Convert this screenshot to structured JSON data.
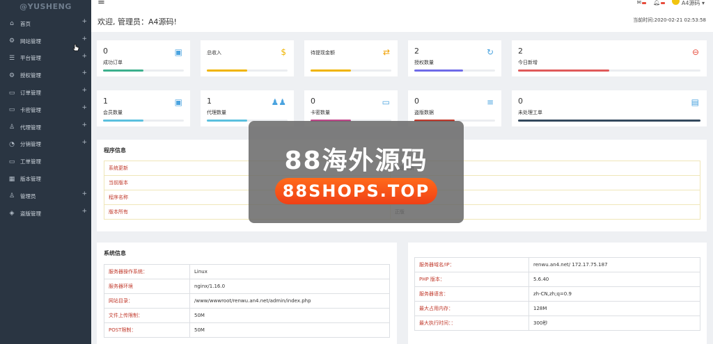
{
  "logo": "@YUSHENG",
  "sidebar": {
    "items": [
      {
        "label": "首页",
        "icon": "home-icon",
        "glyph": "⌂",
        "expand": "+"
      },
      {
        "label": "网站管理",
        "icon": "gear-icon",
        "glyph": "⚙",
        "expand": "+"
      },
      {
        "label": "平台管理",
        "icon": "list-icon",
        "glyph": "☰",
        "expand": "+"
      },
      {
        "label": "授权管理",
        "icon": "settings-icon",
        "glyph": "⚙",
        "expand": "+"
      },
      {
        "label": "订单管理",
        "icon": "folder-icon",
        "glyph": "▭",
        "expand": "+"
      },
      {
        "label": "卡密管理",
        "icon": "card-icon",
        "glyph": "▭",
        "expand": "+"
      },
      {
        "label": "代理管理",
        "icon": "users-icon",
        "glyph": "♙",
        "expand": "+"
      },
      {
        "label": "分销管理",
        "icon": "chart-icon",
        "glyph": "◔",
        "expand": "+"
      },
      {
        "label": "工单管理",
        "icon": "monitor-icon",
        "glyph": "▭",
        "expand": ""
      },
      {
        "label": "版本管理",
        "icon": "grid-icon",
        "glyph": "▦",
        "expand": ""
      },
      {
        "label": "管理员",
        "icon": "user-icon",
        "glyph": "♙",
        "expand": "+"
      },
      {
        "label": "盗版管理",
        "icon": "layers-icon",
        "glyph": "◈",
        "expand": "+"
      }
    ]
  },
  "topbar": {
    "menu_glyph": "≡",
    "welcome": "欢迎, 管理员：A4源码!",
    "username": "A4源码",
    "current_time": "当前时间:2020-02-21 02:53:58"
  },
  "cards": [
    {
      "num": "0",
      "label": "成功订单",
      "icon": "calendar-check-icon",
      "glyph": "▣",
      "color": "#4aa3df",
      "bar_color": "#3cb08d",
      "progress": 0.5
    },
    {
      "num": "",
      "label": "总收入",
      "icon": "dollar-icon",
      "glyph": "$",
      "color": "#f0b400",
      "bar_color": "#f0b400",
      "progress": 0.5
    },
    {
      "num": "",
      "label": "待提现金额",
      "icon": "exchange-icon",
      "glyph": "⇄",
      "color": "#f0a000",
      "bar_color": "#f0b400",
      "progress": 0.5
    },
    {
      "num": "2",
      "label": "授权数量",
      "icon": "refresh-icon",
      "glyph": "↻",
      "color": "#4aa3df",
      "bar_color": "#6e6be8",
      "progress": 0.6
    },
    {
      "num": "2",
      "label": "今日新增",
      "icon": "login-icon",
      "glyph": "⊖",
      "color": "#e74c3c",
      "bar_color": "#e05a5a",
      "progress": 0.5
    },
    {
      "num": "1",
      "label": "会员数量",
      "icon": "contact-icon",
      "glyph": "▣",
      "color": "#4aa3df",
      "bar_color": "#5bc0de",
      "progress": 0.5
    },
    {
      "num": "1",
      "label": "代理数量",
      "icon": "group-icon",
      "glyph": "♟♟",
      "color": "#4aa3df",
      "bar_color": "#5bc0de",
      "progress": 0.5
    },
    {
      "num": "0",
      "label": "卡密数量",
      "icon": "credit-card-icon",
      "glyph": "▭",
      "color": "#4aa3df",
      "bar_color": "#c0468a",
      "progress": 0.5
    },
    {
      "num": "0",
      "label": "盗版数据",
      "icon": "database-icon",
      "glyph": "≡",
      "color": "#4aa3df",
      "bar_color": "#c0392b",
      "progress": 0.5
    },
    {
      "num": "0",
      "label": "未处理工单",
      "icon": "file-icon",
      "glyph": "▤",
      "color": "#4aa3df",
      "bar_color": "#34495e",
      "progress": 1.0
    }
  ],
  "program_info": {
    "title": "程序信息",
    "rows": [
      {
        "key": "系统更新",
        "value": "已是最新"
      },
      {
        "key": "当前版本",
        "value": ""
      },
      {
        "key": "程序名称",
        "value": ""
      },
      {
        "key": "版本所有",
        "value": "正版"
      }
    ]
  },
  "system_info": {
    "title": "系统信息",
    "rows": [
      {
        "key": "服务器操作系统：",
        "value": "Linux"
      },
      {
        "key": "服务器环境",
        "value": "nginx/1.16.0"
      },
      {
        "key": "网站目录：",
        "value": "/www/wwwroot/renwu.an4.net/admin/index.php"
      },
      {
        "key": "文件上传限制：",
        "value": "50M"
      },
      {
        "key": "POST限制：",
        "value": "50M"
      }
    ]
  },
  "server_info": {
    "rows": [
      {
        "key": "服务器域名/IP：",
        "value": "renwu.an4.net/ 172.17.75.187"
      },
      {
        "key": "PHP 版本：",
        "value": "5.6.40"
      },
      {
        "key": "服务器语言：",
        "value": "zh-CN,zh;q=0.9"
      },
      {
        "key": "最大占用内存：",
        "value": "128M"
      },
      {
        "key": "最大执行时间：：",
        "value": "300秒"
      }
    ]
  },
  "watermark": {
    "title": "88海外源码",
    "url": "88SHOPS.TOP"
  }
}
